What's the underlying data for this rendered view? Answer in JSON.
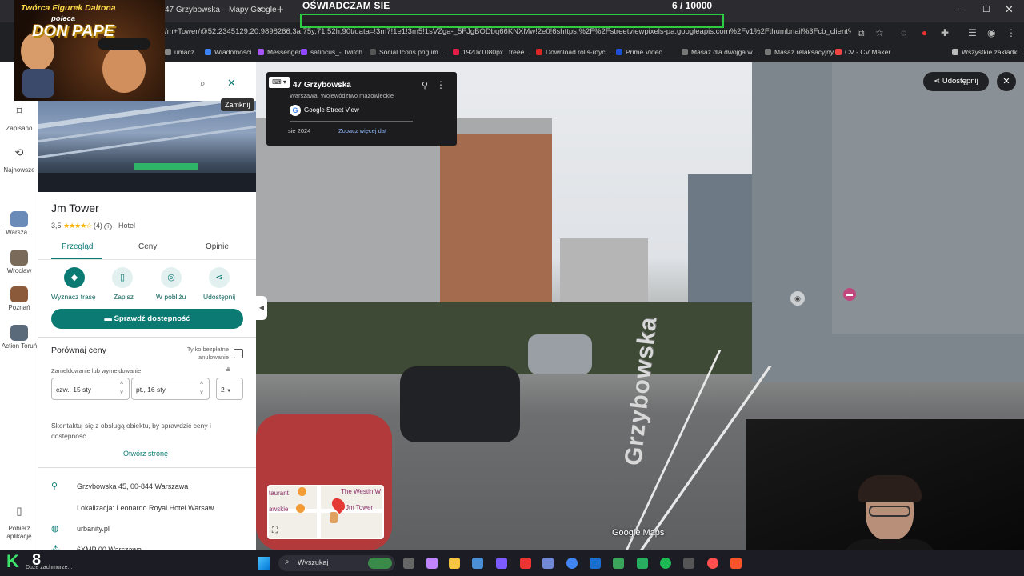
{
  "browser": {
    "tab_title": "47 Grzybowska – Mapy Google",
    "url": "/m+Tower/@52.2345129,20.9898266,3a,75y,71.52h,90t/data=!3m7!1e1!3m5!1sVZga-_5FJgBODbq66KNXMw!2e0!6shttps:%2F%2Fstreetviewpixels-pa.googleapis.com%2Fv1%2Fthumbnail%3Fcb_client%3Dma...",
    "bookmarks": [
      "umacz",
      "Wiadomości",
      "Messenger",
      "satincus_- Twitch",
      "Social Icons png im...",
      "1920x1080px | freee...",
      "Download rolls-royc...",
      "Prime Video",
      "Masaż dla dwojga w...",
      "Masaż relaksacyjny...",
      "CV - CV Maker",
      "Wszystkie zakładki"
    ],
    "bookmark_colors": [
      "#888",
      "#3b82f6",
      "#a855f7",
      "#9146ff",
      "#555",
      "#e11d48",
      "#dc2626",
      "#1d4ed8",
      "#777",
      "#777",
      "#ef4444",
      "#bbb"
    ]
  },
  "overlay": {
    "vow": "OŚWIADCZAM SIE",
    "counter": "6  / 10000",
    "progress": 0.0006,
    "accent": "#2ecc40"
  },
  "ad": {
    "line1": "Twórca Figurek Daltona",
    "line2": "poleca",
    "line3": "DON PAPE"
  },
  "rail": [
    {
      "label": "Zapisano",
      "icon": "bookmark-icon"
    },
    {
      "label": "Najnowsze",
      "icon": "history-icon"
    },
    {
      "label": "Warsza...",
      "icon": "thumb"
    },
    {
      "label": "Wrocław",
      "icon": "thumb"
    },
    {
      "label": "Poznań",
      "icon": "thumb"
    },
    {
      "label": "Action Toruń",
      "icon": "thumb"
    },
    {
      "label": "Pobierz aplikację",
      "icon": "phone-icon"
    }
  ],
  "panel": {
    "tooltip": "Zamknij",
    "title": "Jm Tower",
    "rating_value": "3,5",
    "review_count": "(4)",
    "category": "· Hotel",
    "tabs": [
      "Przegląd",
      "Ceny",
      "Opinie"
    ],
    "actions": [
      "Wyznacz trasę",
      "Zapisz",
      "W pobliżu",
      "Udostępnij"
    ],
    "availability_button": "Sprawdź dostępność",
    "compare_title": "Porównaj ceny",
    "free_cancel": "Tylko bezpłatne anulowanie",
    "checkin_label": "Zameldowanie lub wymeldowanie",
    "checkin": "czw., 15 sty",
    "checkout": "pt., 16 sty",
    "guests": "2",
    "contact_text": "Skontaktuj się z obsługą obiektu, by sprawdzić ceny i dostępność",
    "open_site": "Otwórz stronę",
    "address": "Grzybowska 45, 00-844 Warszawa",
    "located_in": "Lokalizacja: Leonardo Royal Hotel Warsaw",
    "website": "urbanity.pl",
    "plus_code": "6XMP 00 Warszawa"
  },
  "streetview": {
    "address": "47 Grzybowska",
    "region": "Warszawa, Województwo mazowieckie",
    "brand": "Google Street View",
    "date": "sie 2024",
    "more_dates": "Zobacz więcej dat",
    "share": "Udostępnij",
    "street_label": "Grzybowska",
    "watermark": "Google Maps",
    "minimap_labels": [
      "taurant",
      "The Westin W",
      "awskie",
      "Jm Tower"
    ]
  },
  "taskbar": {
    "search": "Wyszukaj",
    "tray_text": "Duże zachmurze...",
    "tray_num": "8"
  }
}
